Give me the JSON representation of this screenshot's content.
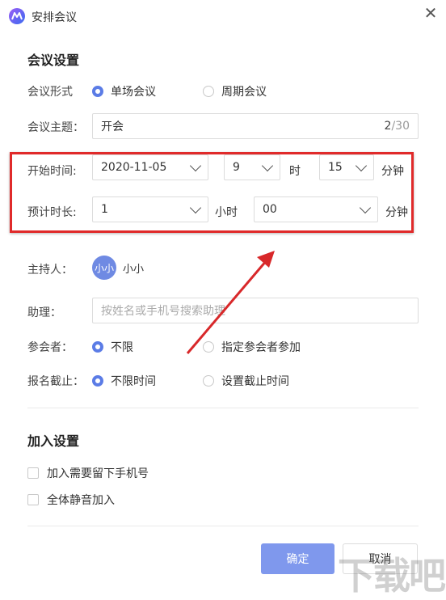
{
  "window": {
    "title": "安排会议",
    "close_glyph": "✕"
  },
  "meeting": {
    "section_title": "会议设置",
    "type": {
      "label": "会议形式",
      "options": [
        "单场会议",
        "周期会议"
      ],
      "selected": "单场会议"
    },
    "topic": {
      "label": "会议主题：",
      "value": "开会",
      "count": "2",
      "max": "/30"
    },
    "start": {
      "label": "开始时间:",
      "date": "2020-11-05",
      "hour": "9",
      "hour_unit": "时",
      "minute": "15",
      "minute_unit": "分钟"
    },
    "duration": {
      "label": "预计时长:",
      "hours": "1",
      "hours_unit": "小时",
      "minutes": "00",
      "minutes_unit": "分钟"
    },
    "host": {
      "label": "主持人：",
      "avatar_text": "小小",
      "name": "小小"
    },
    "assistant": {
      "label": "助理：",
      "placeholder": "按姓名或手机号搜索助理"
    },
    "participants": {
      "label": "参会者：",
      "options": [
        "不限",
        "指定参会者参加"
      ],
      "selected": "不限"
    },
    "deadline": {
      "label": "报名截止：",
      "options": [
        "不限时间",
        "设置截止时间"
      ],
      "selected": "不限时间"
    }
  },
  "join": {
    "section_title": "加入设置",
    "options": [
      "加入需要留下手机号",
      "全体静音加入"
    ]
  },
  "buttons": {
    "confirm": "确定",
    "cancel": "取消"
  },
  "watermark": "下载吧",
  "colors": {
    "accent": "#5b7ce6",
    "confirm_bg": "#7f98ed",
    "annotation": "#e02a2a"
  }
}
